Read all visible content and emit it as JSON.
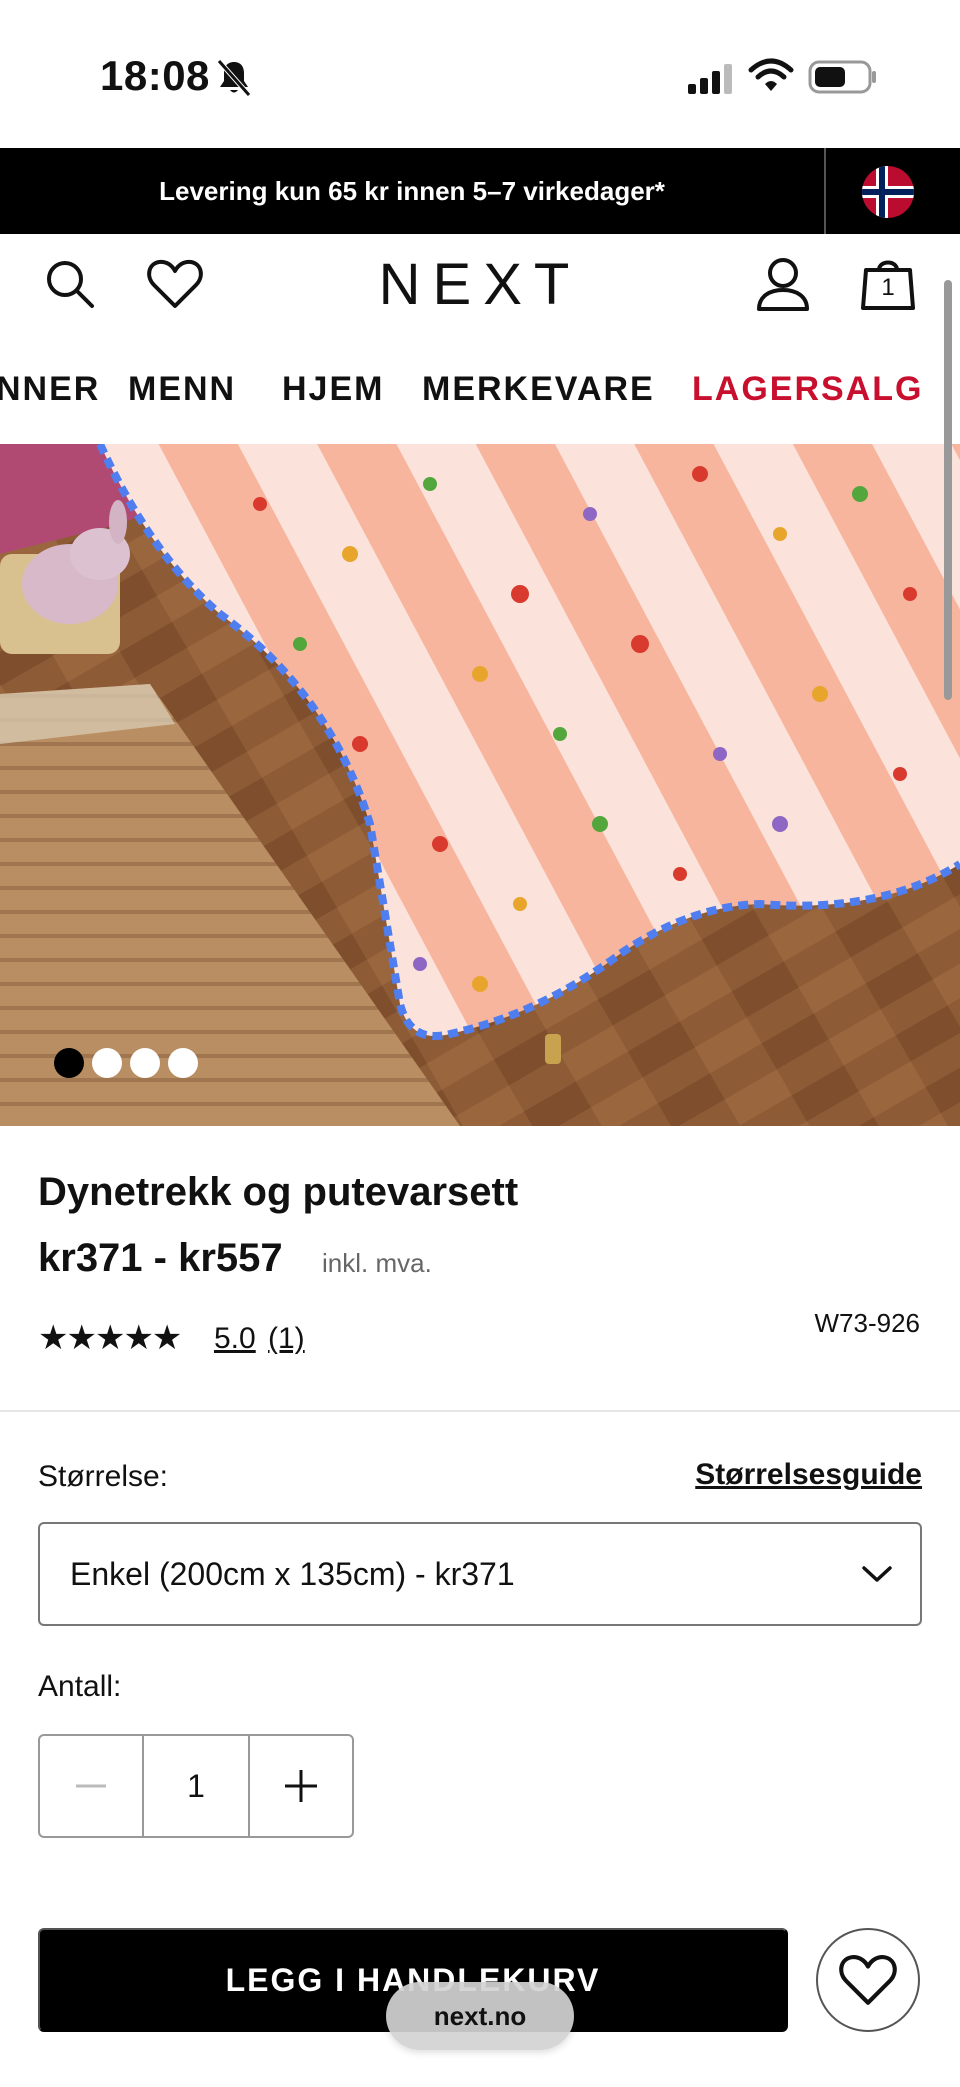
{
  "status_bar": {
    "time": "18:08",
    "icons": [
      "bell-slash-icon",
      "signal-icon",
      "wifi-icon",
      "battery-icon"
    ]
  },
  "promo": {
    "text": "Levering kun 65 kr innen 5–7 virkedager*",
    "flag": "norway-flag-icon"
  },
  "header": {
    "logo": "NEXT",
    "bag_count": "1",
    "icons": [
      "search-icon",
      "heart-icon",
      "account-icon",
      "bag-icon"
    ]
  },
  "categories": [
    {
      "label": "NNER"
    },
    {
      "label": "MENN"
    },
    {
      "label": "HJEM"
    },
    {
      "label": "MERKEVARE"
    },
    {
      "label": "LAGERSALG"
    }
  ],
  "gallery": {
    "image_count": 4,
    "active_index": 0
  },
  "product": {
    "title": "Dynetrekk og putevarsett",
    "price": "kr371 - kr557",
    "tax_note": "inkl. mva.",
    "stars": "★★★★★",
    "rating": "5.0",
    "review_count": "(1)",
    "code": "W73-926"
  },
  "size": {
    "label": "Størrelse:",
    "guide_link": "Størrelsesguide",
    "selected": "Enkel (200cm x 135cm) - kr371"
  },
  "quantity": {
    "label": "Antall:",
    "value": "1"
  },
  "actions": {
    "add_to_bag": "LEGG I HANDLEKURV"
  },
  "browser": {
    "url": "next.no"
  },
  "colors": {
    "sale": "#c8102e",
    "black": "#000000"
  }
}
